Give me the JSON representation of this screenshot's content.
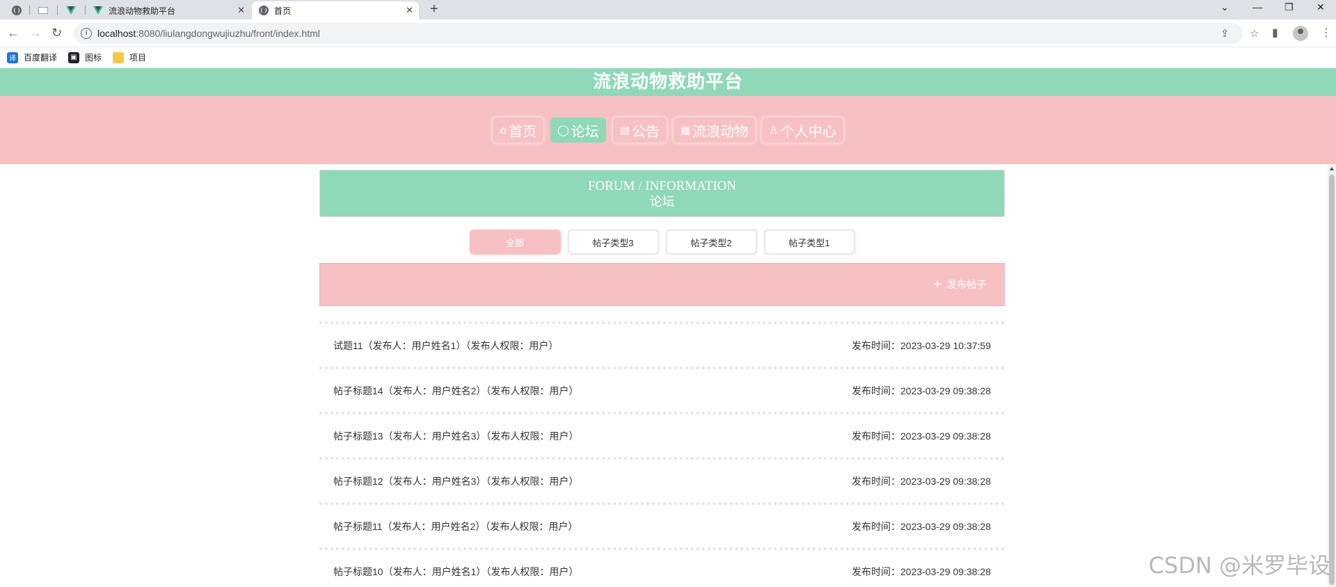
{
  "browser": {
    "tabs": [
      {
        "title": "流浪动物救助平台",
        "active": false
      },
      {
        "title": "首页",
        "active": true
      }
    ],
    "new_tab": "+",
    "url_host": "localhost",
    "url_path": ":8080/liulangdongwujiuzhu/front/index.html",
    "bookmarks": [
      {
        "label": "百度翻译",
        "icon": "translate-icon"
      },
      {
        "label": "图标",
        "icon": "image-icon"
      },
      {
        "label": "项目",
        "icon": "folder-icon"
      }
    ]
  },
  "site": {
    "title": "流浪动物救助平台",
    "menu": [
      {
        "label": "首页",
        "icon": "home-icon",
        "active": false
      },
      {
        "label": "论坛",
        "icon": "chat-icon",
        "active": true
      },
      {
        "label": "公告",
        "icon": "notice-icon",
        "active": false
      },
      {
        "label": "流浪动物",
        "icon": "grid-icon",
        "active": false
      },
      {
        "label": "个人中心",
        "icon": "user-icon",
        "active": false
      }
    ]
  },
  "forum": {
    "banner_en": "FORUM / INFORMATION",
    "banner_cn": "论坛",
    "filters": [
      {
        "label": "全部",
        "active": true
      },
      {
        "label": "帖子类型3",
        "active": false
      },
      {
        "label": "帖子类型2",
        "active": false
      },
      {
        "label": "帖子类型1",
        "active": false
      }
    ],
    "publish_label": "发布帖子",
    "posts": [
      {
        "title": "试题11（发布人：用户姓名1）（发布人权限：用户）",
        "time": "发布时间：2023-03-29 10:37:59"
      },
      {
        "title": "帖子标题14（发布人：用户姓名2）（发布人权限：用户）",
        "time": "发布时间：2023-03-29 09:38:28"
      },
      {
        "title": "帖子标题13（发布人：用户姓名3）（发布人权限：用户）",
        "time": "发布时间：2023-03-29 09:38:28"
      },
      {
        "title": "帖子标题12（发布人：用户姓名3）（发布人权限：用户）",
        "time": "发布时间：2023-03-29 09:38:28"
      },
      {
        "title": "帖子标题11（发布人：用户姓名2）（发布人权限：用户）",
        "time": "发布时间：2023-03-29 09:38:28"
      },
      {
        "title": "帖子标题10（发布人：用户姓名1）（发布人权限：用户）",
        "time": "发布时间：2023-03-29 09:38:28"
      }
    ]
  },
  "watermark": "CSDN @米罗毕设",
  "colors": {
    "green": "#8fd8b8",
    "pink": "#f7c1c3",
    "chrome_bg": "#dee1e6"
  }
}
